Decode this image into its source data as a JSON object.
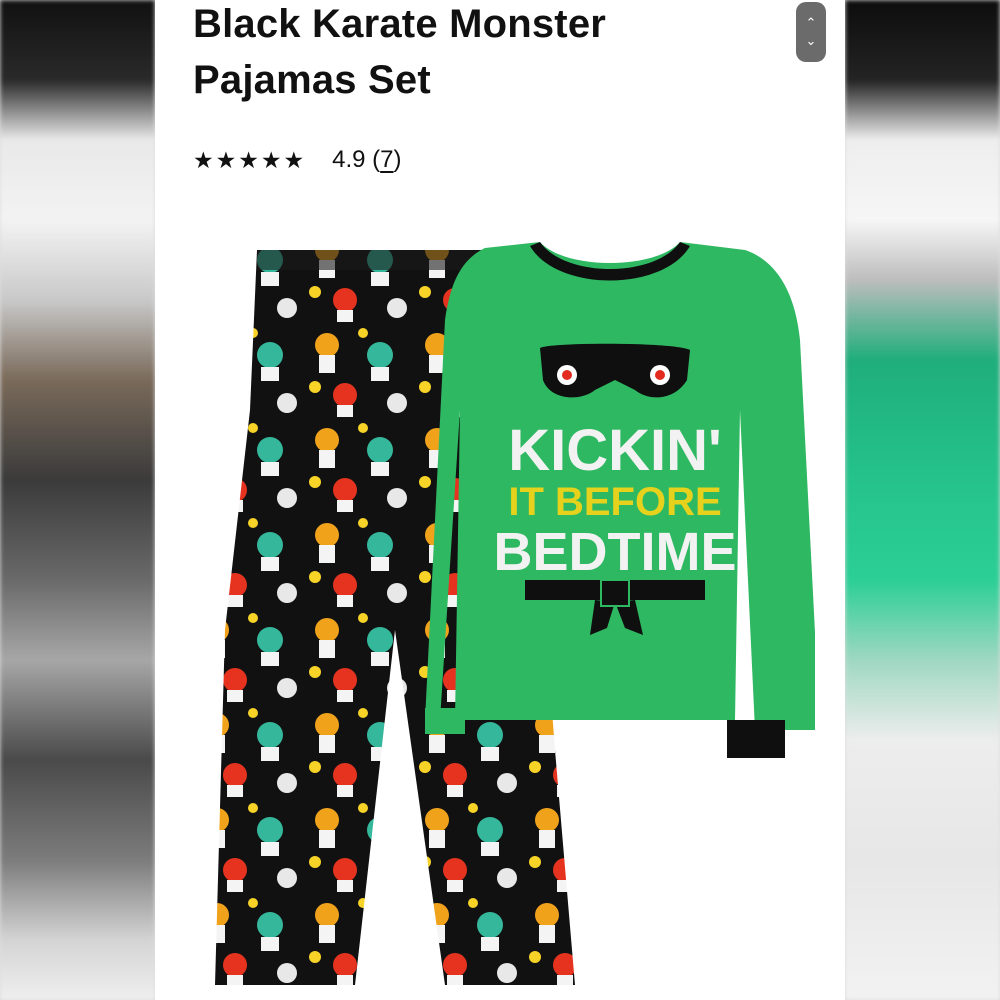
{
  "product": {
    "title": "Black Karate Monster Pajamas Set",
    "rating_value": "4.9",
    "rating_count": "7",
    "rating_stars": 5
  },
  "shirt_print": {
    "line1": "KICKIN'",
    "line2": "IT BEFORE",
    "line3": "BEDTIME"
  },
  "scroll_widget": {
    "up": "⌃",
    "down": "⌄"
  },
  "colors": {
    "shirt_green": "#2fb862",
    "pants_black": "#111111",
    "text_yellow": "#e6d21c"
  },
  "icons": [
    "star-icon",
    "chevron-up-icon",
    "chevron-down-icon"
  ]
}
